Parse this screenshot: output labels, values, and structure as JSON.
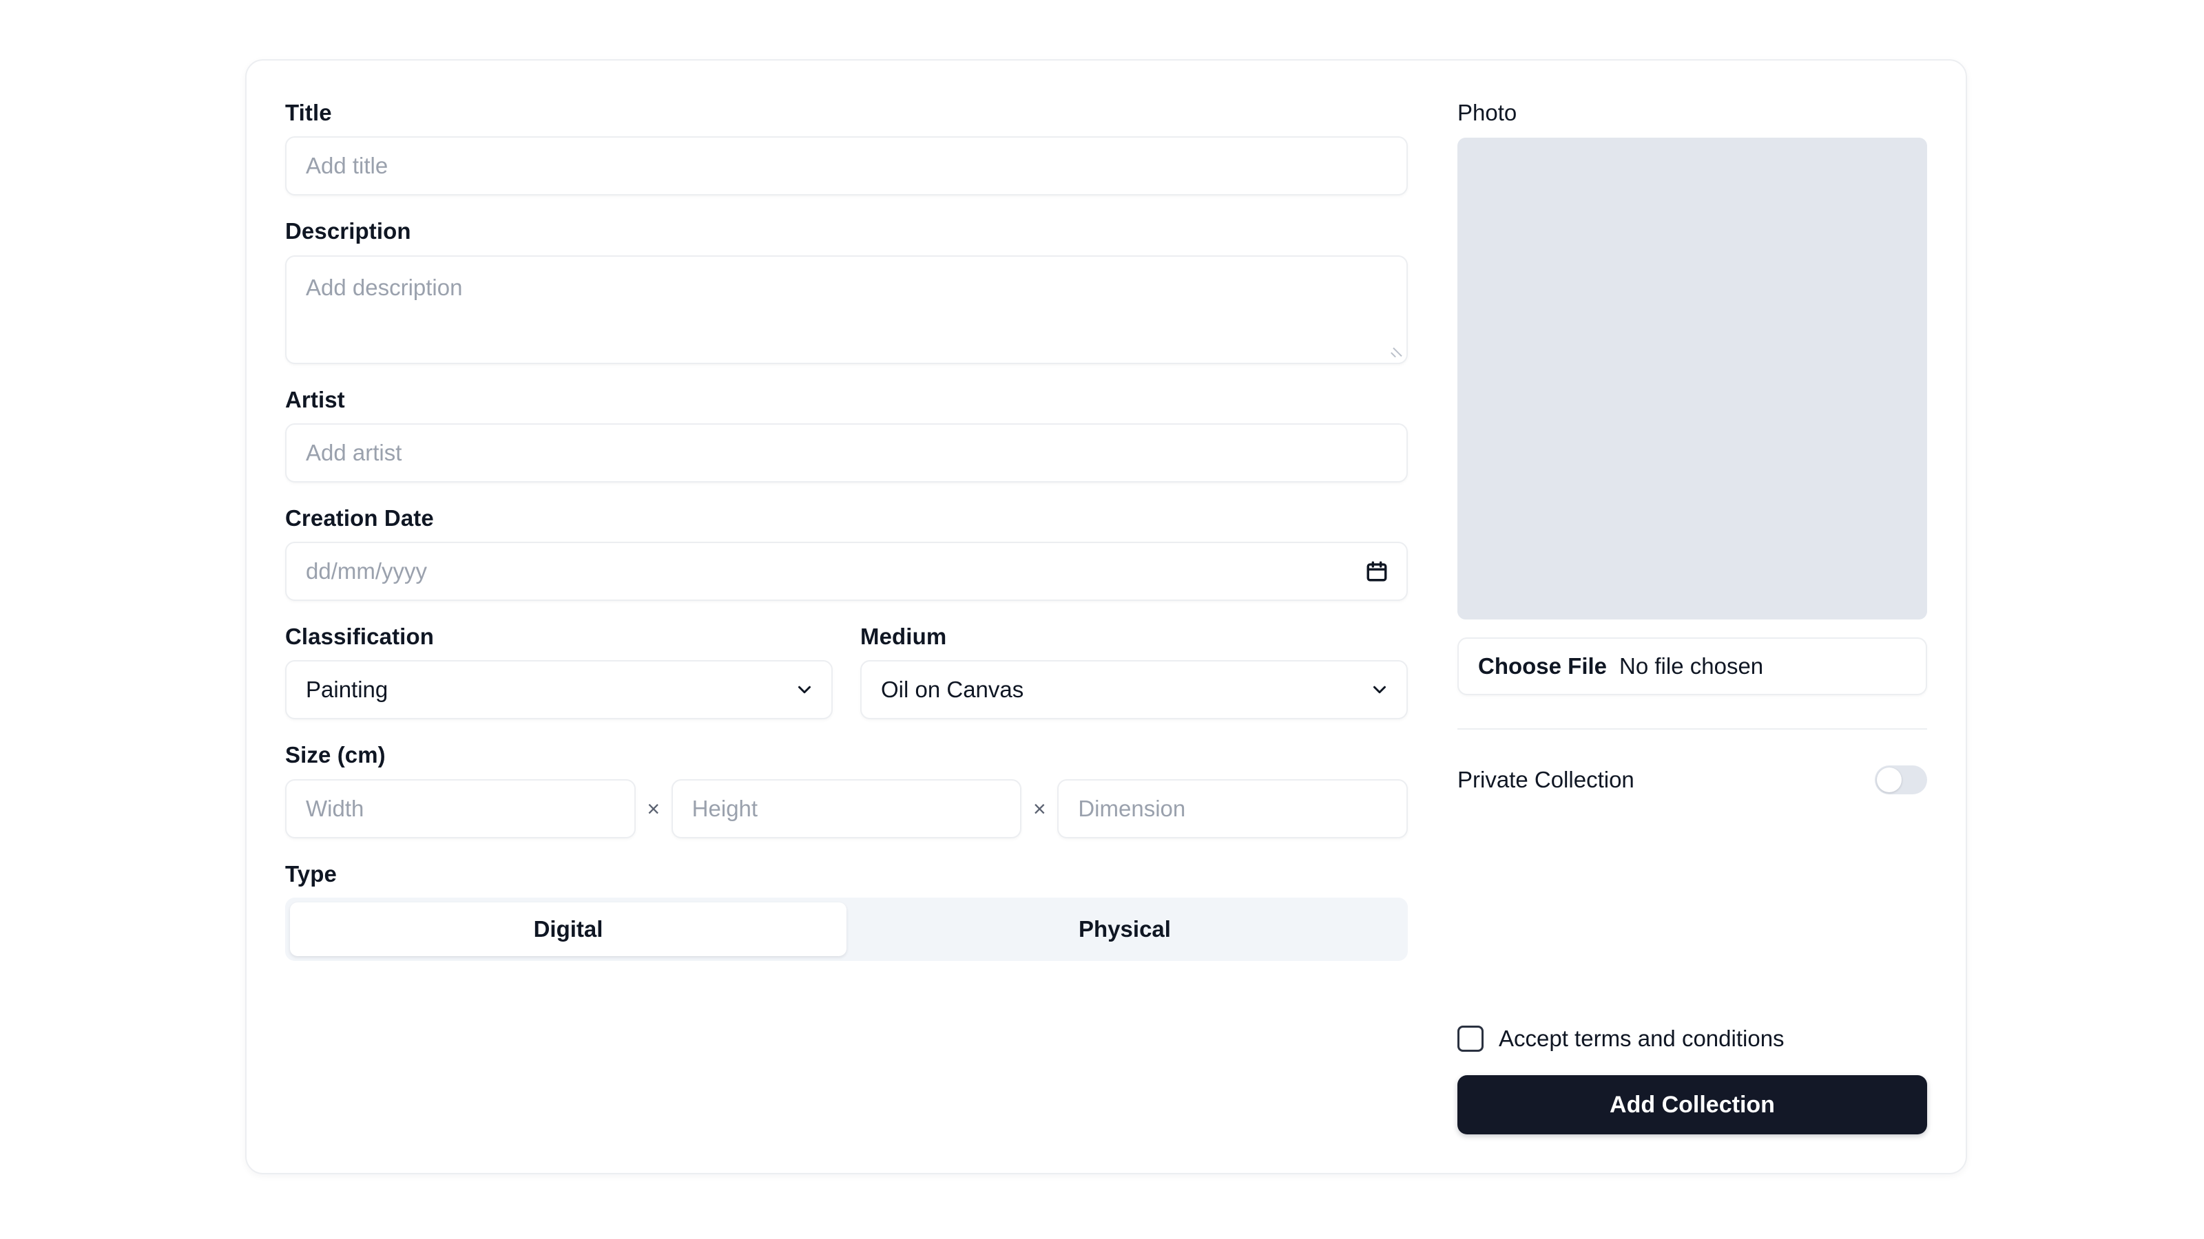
{
  "form": {
    "title": {
      "label": "Title",
      "placeholder": "Add title",
      "value": ""
    },
    "description": {
      "label": "Description",
      "placeholder": "Add description",
      "value": ""
    },
    "artist": {
      "label": "Artist",
      "placeholder": "Add artist",
      "value": ""
    },
    "creation_date": {
      "label": "Creation Date",
      "placeholder": "dd/mm/yyyy",
      "value": "",
      "icon": "calendar-icon"
    },
    "classification": {
      "label": "Classification",
      "selected": "Painting",
      "options": [
        "Painting"
      ],
      "icon": "chevron-down-icon"
    },
    "medium": {
      "label": "Medium",
      "selected": "Oil on Canvas",
      "options": [
        "Oil on Canvas"
      ],
      "icon": "chevron-down-icon"
    },
    "size": {
      "label": "Size (cm)",
      "separator": "×",
      "width": {
        "placeholder": "Width",
        "value": ""
      },
      "height": {
        "placeholder": "Height",
        "value": ""
      },
      "dimension": {
        "placeholder": "Dimension",
        "value": ""
      }
    },
    "type": {
      "label": "Type",
      "options": [
        "Digital",
        "Physical"
      ],
      "selected": "Digital"
    }
  },
  "sidebar": {
    "photo": {
      "label": "Photo",
      "placeholder_state": "empty"
    },
    "file": {
      "button_label": "Choose File",
      "status": "No file chosen"
    },
    "private_collection": {
      "label": "Private Collection",
      "state": "off"
    },
    "terms": {
      "label": "Accept terms and conditions",
      "checked": false
    },
    "submit": {
      "label": "Add Collection"
    }
  },
  "colors": {
    "page_background": "#ffffff",
    "card_border": "#eceef1",
    "text_primary": "#0f1623",
    "placeholder": "#9aa1ad",
    "photo_placeholder": "#e2e6ed",
    "segment_track": "#f2f5f9",
    "primary_button": "#131827",
    "switch_track": "#e2e6ed"
  }
}
